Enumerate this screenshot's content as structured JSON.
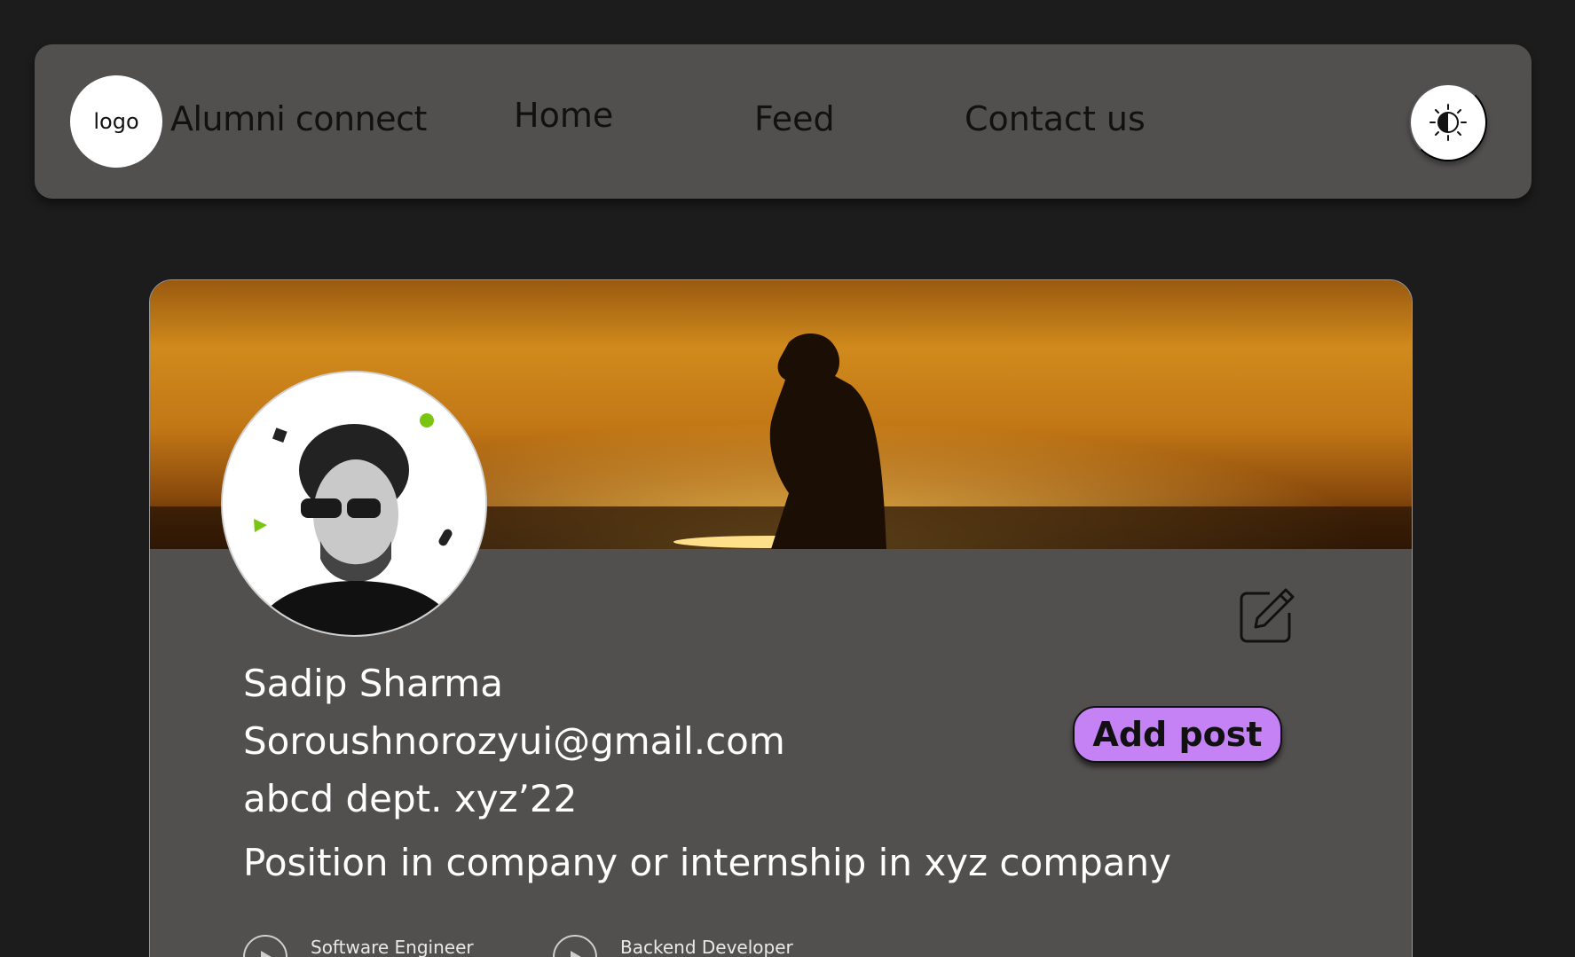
{
  "nav": {
    "logo_label": "logo",
    "brand": "Alumni connect",
    "links": [
      "Home",
      "Feed",
      "Contact us"
    ],
    "theme_icon": "contrast-sun-icon"
  },
  "profile": {
    "name": "Sadip Sharma",
    "email": "Soroushnorozyui@gmail.com",
    "dept": "abcd dept. xyz’22",
    "position": "Position in company or internship in xyz company",
    "add_post_label": "Add post",
    "edit_icon": "edit-icon",
    "tags": [
      "Software Engineer",
      "Backend Developer"
    ]
  },
  "colors": {
    "background": "#1c1c1c",
    "panel": "#524f4f",
    "accent": "#c482f5"
  }
}
